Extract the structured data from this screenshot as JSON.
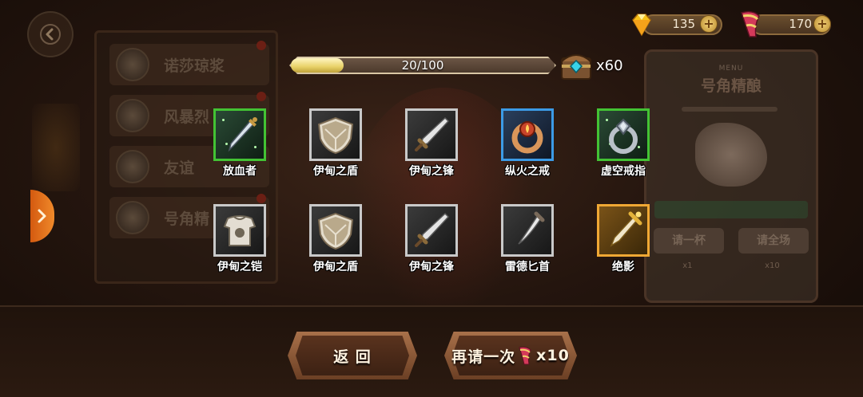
{
  "currency": {
    "gems": "135",
    "horns": "170",
    "plus_symbol": "+"
  },
  "progress": {
    "text": "20/100",
    "fraction": 0.2
  },
  "chest": {
    "count": "x60"
  },
  "items": [
    {
      "name": "放血者",
      "rarity": "green",
      "icon": "dagger-icon"
    },
    {
      "name": "伊甸之盾",
      "rarity": "white",
      "icon": "shield-icon"
    },
    {
      "name": "伊甸之锋",
      "rarity": "white",
      "icon": "sword-icon"
    },
    {
      "name": "纵火之戒",
      "rarity": "blue",
      "icon": "fire-ring-icon"
    },
    {
      "name": "虚空戒指",
      "rarity": "green",
      "icon": "void-ring-icon"
    },
    {
      "name": "伊甸之铠",
      "rarity": "white",
      "icon": "armor-icon"
    },
    {
      "name": "伊甸之盾",
      "rarity": "white",
      "icon": "shield-icon"
    },
    {
      "name": "伊甸之锋",
      "rarity": "white",
      "icon": "sword-icon"
    },
    {
      "name": "雷德匕首",
      "rarity": "white",
      "icon": "curved-dagger-icon"
    },
    {
      "name": "绝影",
      "rarity": "orange",
      "icon": "golden-dagger-icon"
    }
  ],
  "buttons": {
    "back": "返 回",
    "again": "再请一次",
    "again_cost": "x10"
  },
  "background": {
    "left_tabs": [
      "诺莎琼浆",
      "风暴烈",
      "友谊",
      "号角精"
    ],
    "menu_label": "MENU",
    "panel_title": "号角精酿",
    "panel_buttons": [
      "请一杯",
      "请全场"
    ],
    "panel_costs": [
      "x1",
      "x10"
    ]
  },
  "colors": {
    "green_frame": "#43c334",
    "white_frame": "#c9c9c9",
    "blue_frame": "#3c9be6",
    "orange_frame": "#f0a834",
    "progress_fill": "#e8d167",
    "side_arrow": "#f08a2a"
  }
}
